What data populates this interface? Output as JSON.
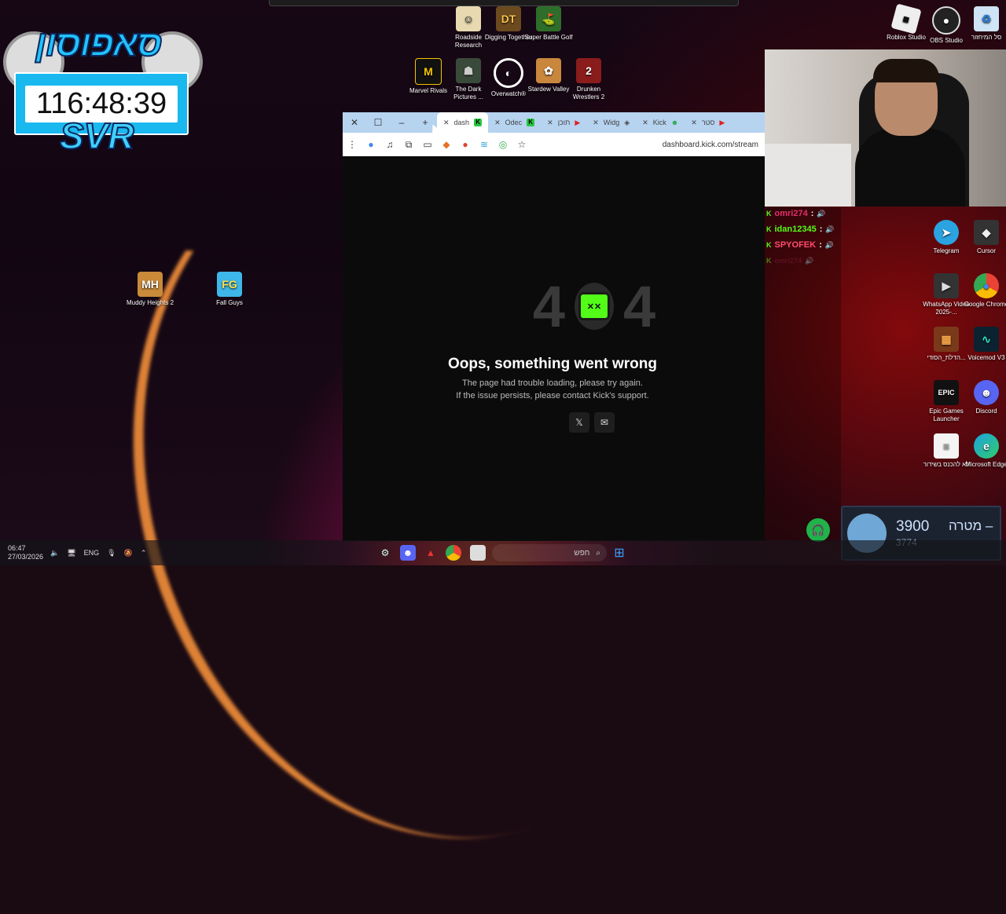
{
  "overlay": {
    "logo_text": "סאפוסון",
    "timer": "116:48:39",
    "tag": "SVR"
  },
  "desktop_icons": {
    "roadside": "Roadside Research",
    "digging": "Digging Together",
    "golf": "Super Battle Golf",
    "marvel": "Marvel Rivals",
    "darkpictures": "The Dark Pictures ...",
    "overwatch": "Overwatch®",
    "stardew": "Stardew Valley",
    "drunken": "Drunken Wrestlers 2",
    "muddy": "Muddy Heights 2",
    "fallguys": "Fall Guys",
    "roblox": "Roblox Studio",
    "obs": "OBS Studio",
    "recycle": "סל המיחזור",
    "telegram": "Telegram",
    "cursor": "Cursor",
    "whatsapp": "WhatsApp Video 2025-...",
    "chrome": "Google Chrome",
    "burn": "הדלת_הסודי...",
    "voicemod": "Voicemod V3",
    "epic": "Epic Games Launcher",
    "discord": "Discord",
    "doc": "לא להכנס בשידור",
    "edge": "Microsoft Edge"
  },
  "browser": {
    "tabs": [
      {
        "label": "dash",
        "active": true
      },
      {
        "label": "Odec",
        "active": false
      },
      {
        "label": "תוכן",
        "active": false
      },
      {
        "label": "Widg",
        "active": false
      },
      {
        "label": "Kick",
        "active": false
      },
      {
        "label": "סטר",
        "active": false
      }
    ],
    "url": "dashboard.kick.com/stream",
    "error": {
      "code_left": "4",
      "code_right": "4",
      "title": "Oops, something went wrong",
      "line1": "The page had trouble loading, please try again.",
      "line2": "If the issue persists, please contact Kick's support."
    }
  },
  "chat": [
    {
      "user": "omri274",
      "color": "#e0306a",
      "sep": ":"
    },
    {
      "user": "idan12345",
      "color": "#53fc18",
      "sep": ":"
    },
    {
      "user": "SPYOFEK",
      "color": "#ff4d6d",
      "sep": ":"
    },
    {
      "user": "omri274",
      "color": "#7a1e3a",
      "sep": ""
    }
  ],
  "goal": {
    "current": "3900",
    "label": "מטרה –",
    "sub": "3774"
  },
  "taskbar": {
    "time": "06:47",
    "date": "27/03/2026",
    "lang": "ENG",
    "search_placeholder": "חפש"
  },
  "colors": {
    "kick_green": "#53fc18",
    "tabstrip": "#b6d3f0"
  }
}
